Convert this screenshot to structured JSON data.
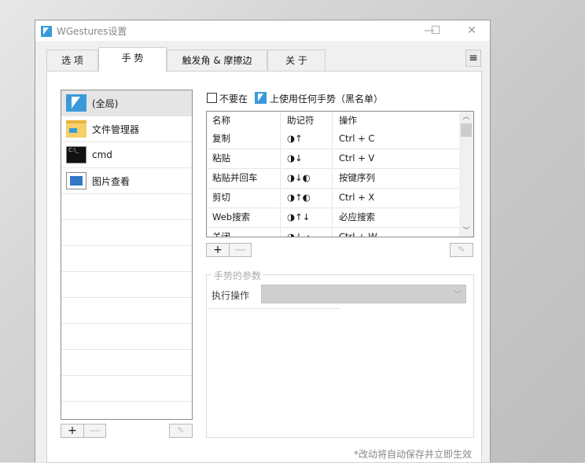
{
  "window": {
    "title": "WGestures设置",
    "minimize": "—",
    "maximize": "☐",
    "close": "✕"
  },
  "tabs": [
    {
      "label": "选 项"
    },
    {
      "label": "手 势"
    },
    {
      "label": "触发角 & 摩擦边"
    },
    {
      "label": "关 于"
    }
  ],
  "menu_icon": "hamburger-icon",
  "apps": [
    {
      "label": "(全局)",
      "icon": "cursor-icon",
      "selected": true
    },
    {
      "label": "文件管理器",
      "icon": "folder-icon"
    },
    {
      "label": "cmd",
      "icon": "terminal-icon"
    },
    {
      "label": "图片查看",
      "icon": "image-viewer-icon"
    }
  ],
  "app_buttons": {
    "add": "+",
    "remove": "—"
  },
  "blacklist": {
    "checked": false,
    "prefix": "不要在",
    "suffix": "上使用任何手势（黑名单）"
  },
  "gestures": {
    "columns": [
      "名称",
      "助记符",
      "操作"
    ],
    "rows": [
      [
        "复制",
        "◑↑",
        "Ctrl + C"
      ],
      [
        "粘贴",
        "◑↓",
        "Ctrl + V"
      ],
      [
        "粘贴并回车",
        "◑↓◐",
        "按键序列"
      ],
      [
        "剪切",
        "◑↑◐",
        "Ctrl + X"
      ],
      [
        "Web搜索",
        "◑↑↓",
        "必应搜索"
      ],
      [
        "关闭",
        "◑↓→",
        "Ctrl + W"
      ]
    ]
  },
  "gesture_buttons": {
    "add": "+",
    "remove": "—"
  },
  "params": {
    "title": "手势的参数",
    "action_label": "执行操作",
    "action_value": ""
  },
  "footer_note": "*改动将自动保存并立即生效"
}
